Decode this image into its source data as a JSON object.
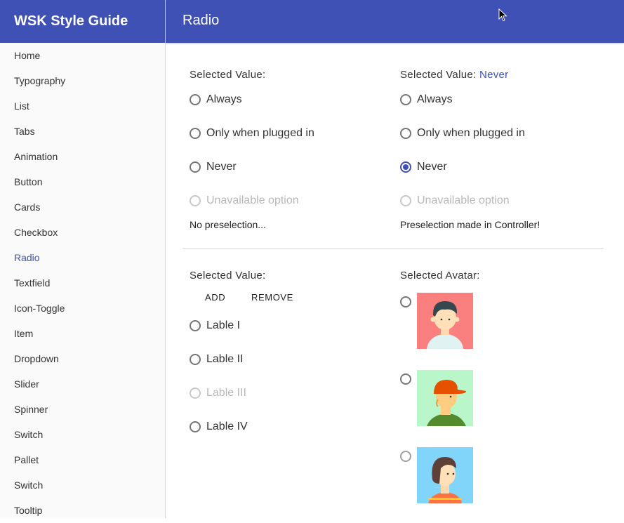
{
  "app": {
    "brand": "WSK Style Guide",
    "page_title": "Radio"
  },
  "sidebar": {
    "items": [
      {
        "label": "Home"
      },
      {
        "label": "Typography"
      },
      {
        "label": "List"
      },
      {
        "label": "Tabs"
      },
      {
        "label": "Animation"
      },
      {
        "label": "Button"
      },
      {
        "label": "Cards"
      },
      {
        "label": "Checkbox"
      },
      {
        "label": "Radio",
        "active": true
      },
      {
        "label": "Textfield"
      },
      {
        "label": "Icon-Toggle"
      },
      {
        "label": "Item"
      },
      {
        "label": "Dropdown"
      },
      {
        "label": "Slider"
      },
      {
        "label": "Spinner"
      },
      {
        "label": "Switch"
      },
      {
        "label": "Pallet"
      },
      {
        "label": "Switch"
      },
      {
        "label": "Tooltip"
      }
    ],
    "active_color": "#3f51b5"
  },
  "colors": {
    "primary": "#3f51b5",
    "disabled": "#b8b8b8"
  },
  "section1": {
    "left": {
      "label": "Selected Value:",
      "value": "",
      "options": [
        "Always",
        "Only when plugged in",
        "Never",
        "Unavailable option"
      ],
      "note": "No preselection..."
    },
    "right": {
      "label": "Selected Value:",
      "value": "Never",
      "options": [
        "Always",
        "Only when plugged in",
        "Never",
        "Unavailable option"
      ],
      "note": "Preselection made in Controller!"
    }
  },
  "section2": {
    "left": {
      "label": "Selected Value:",
      "add_label": "ADD",
      "remove_label": "REMOVE",
      "options": [
        "Lable I",
        "Lable II",
        "Lable III",
        "Lable IV"
      ]
    },
    "right": {
      "label": "Selected Avatar:",
      "avatars": [
        {
          "name": "avatar-1",
          "bg": "#fa8072"
        },
        {
          "name": "avatar-2",
          "bg": "#b9f6ca"
        },
        {
          "name": "avatar-3",
          "bg": "#81d4fa"
        }
      ]
    }
  }
}
